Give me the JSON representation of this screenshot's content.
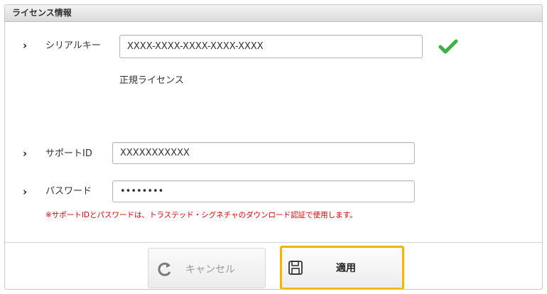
{
  "panel": {
    "title": "ライセンス情報"
  },
  "serial": {
    "label": "シリアルキー",
    "value": "XXXX-XXXX-XXXX-XXXX-XXXX",
    "status": "正規ライセンス"
  },
  "support": {
    "label": "サポートID",
    "value": "XXXXXXXXXXX"
  },
  "password": {
    "label": "パスワード",
    "value": "••••••••"
  },
  "note": "※サポートIDとパスワードは、トラステッド・シグネチャのダウンロード認証で使用します。",
  "buttons": {
    "cancel_label": "キャンセル",
    "apply_label": "適用"
  },
  "colors": {
    "check": "#3cb043",
    "note": "#e00000",
    "apply_border": "#f5b400"
  },
  "icons": {
    "row_marker": "chevron-right-icon",
    "valid": "checkmark-icon",
    "cancel": "refresh-icon",
    "apply": "save-icon"
  }
}
